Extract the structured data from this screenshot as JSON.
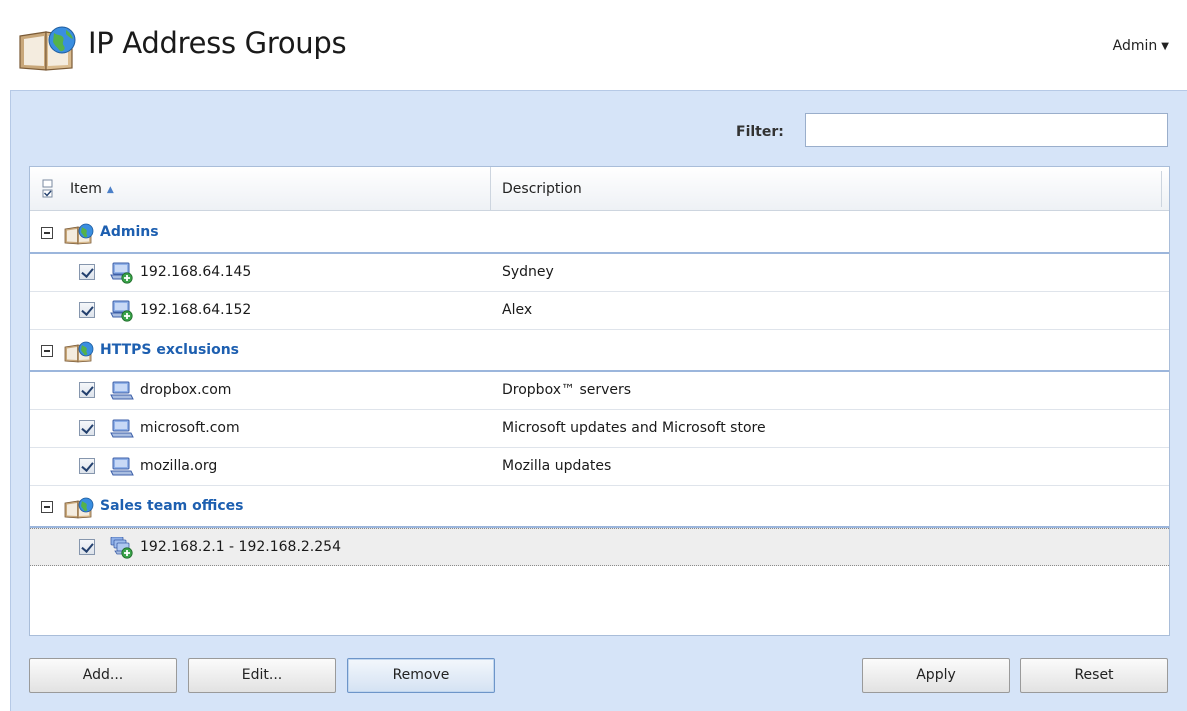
{
  "header": {
    "title": "IP Address Groups",
    "user_menu": "Admin",
    "app_icon": "address-book-globe-icon"
  },
  "filter": {
    "label": "Filter:",
    "value": ""
  },
  "grid": {
    "columns": {
      "item": "Item",
      "description": "Description"
    },
    "sort": "ascending",
    "groups": [
      {
        "name": "Admins",
        "expanded": true,
        "items": [
          {
            "item": "192.168.64.145",
            "description": "Sydney",
            "checked": true,
            "icon": "ip-address-icon"
          },
          {
            "item": "192.168.64.152",
            "description": "Alex",
            "checked": true,
            "icon": "ip-address-icon"
          }
        ]
      },
      {
        "name": "HTTPS exclusions",
        "expanded": true,
        "items": [
          {
            "item": "dropbox.com",
            "description": "Dropbox™ servers",
            "checked": true,
            "icon": "computer-icon"
          },
          {
            "item": "microsoft.com",
            "description": "Microsoft updates and Microsoft store",
            "checked": true,
            "icon": "computer-icon"
          },
          {
            "item": "mozilla.org",
            "description": "Mozilla updates",
            "checked": true,
            "icon": "computer-icon"
          }
        ]
      },
      {
        "name": "Sales team offices",
        "expanded": true,
        "items": [
          {
            "item": "192.168.2.1 - 192.168.2.254",
            "description": "",
            "checked": true,
            "icon": "ip-range-icon",
            "selected": true
          }
        ]
      }
    ]
  },
  "buttons": {
    "add": "Add...",
    "edit": "Edit...",
    "remove": "Remove",
    "apply": "Apply",
    "reset": "Reset"
  },
  "colors": {
    "panel_bg": "#d6e4f8",
    "group_label": "#1d5fb0",
    "group_divider": "#9cb6dc"
  }
}
